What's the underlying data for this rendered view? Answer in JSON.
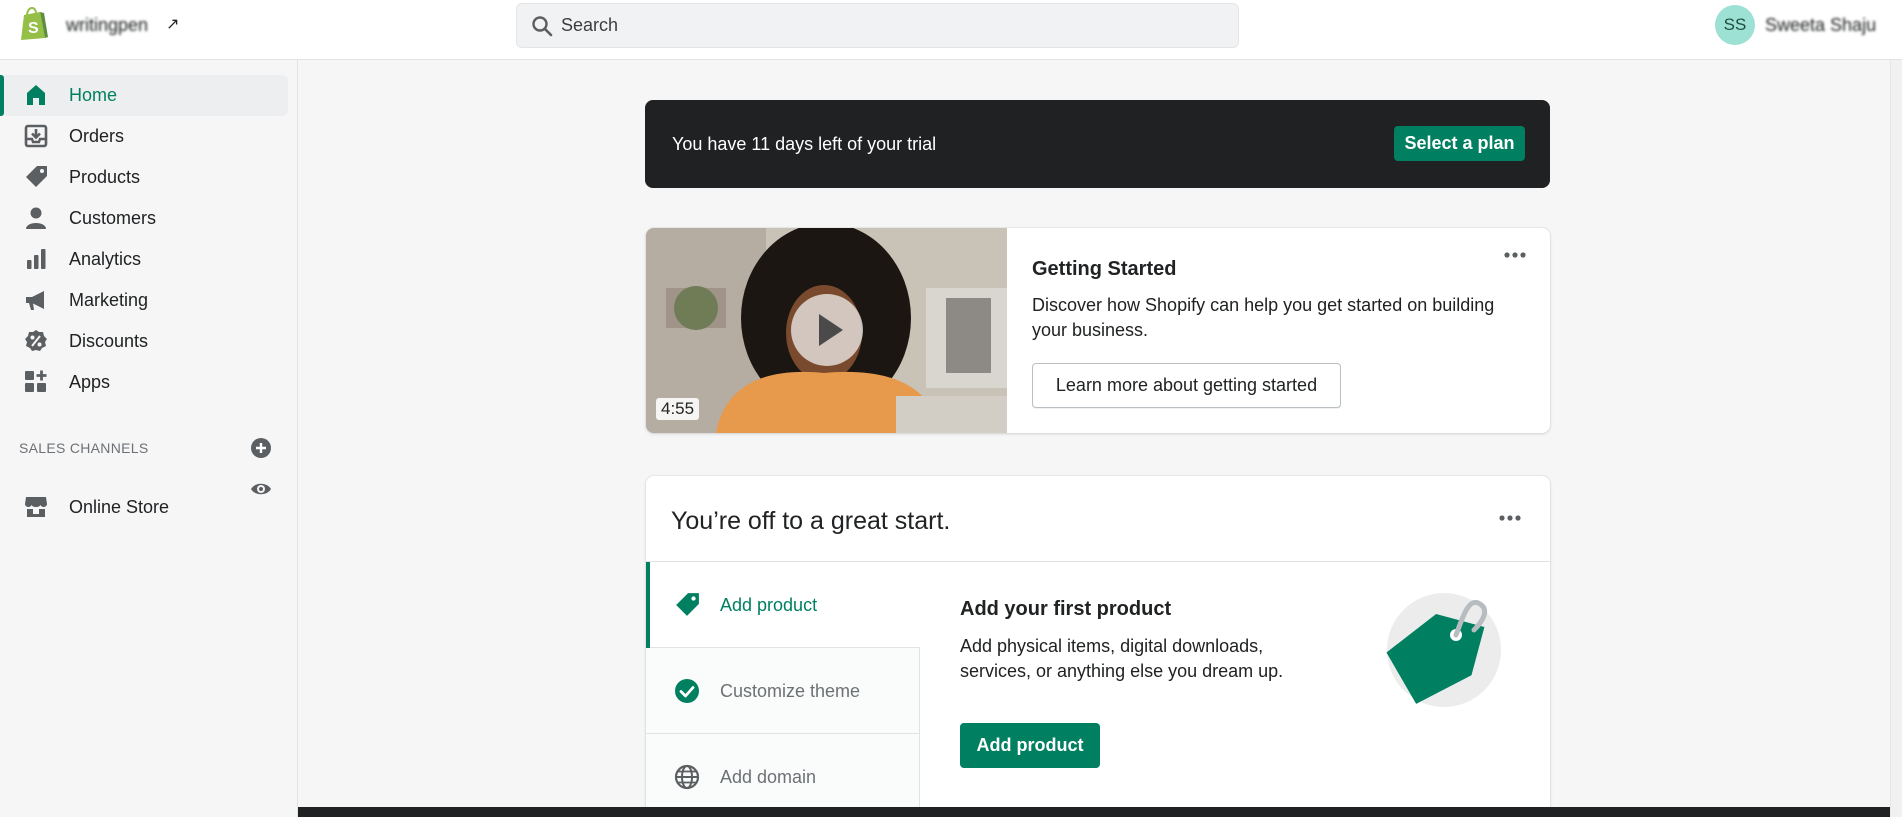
{
  "topbar": {
    "store_name": "writingpen",
    "search_placeholder": "Search",
    "avatar_initials": "SS",
    "user_name": "Sweeta Shaju"
  },
  "sidebar": {
    "items": [
      {
        "label": "Home",
        "icon": "home-icon",
        "active": true
      },
      {
        "label": "Orders",
        "icon": "orders-icon"
      },
      {
        "label": "Products",
        "icon": "tag-icon"
      },
      {
        "label": "Customers",
        "icon": "person-icon"
      },
      {
        "label": "Analytics",
        "icon": "bar-chart-icon"
      },
      {
        "label": "Marketing",
        "icon": "megaphone-icon"
      },
      {
        "label": "Discounts",
        "icon": "discount-icon"
      },
      {
        "label": "Apps",
        "icon": "apps-icon"
      }
    ],
    "sales_channels_title": "SALES CHANNELS",
    "online_store_label": "Online Store"
  },
  "trial": {
    "text": "You have 11 days left of your trial",
    "button": "Select a plan"
  },
  "getting_started": {
    "duration": "4:55",
    "title": "Getting Started",
    "description": "Discover how Shopify can help you get started on building your business.",
    "button": "Learn more about getting started"
  },
  "setup": {
    "title": "You’re off to a great start.",
    "tasks": [
      {
        "label": "Add product",
        "icon": "tag-icon",
        "active": true
      },
      {
        "label": "Customize theme",
        "icon": "check-circle-icon"
      },
      {
        "label": "Add domain",
        "icon": "globe-icon"
      }
    ],
    "detail_title": "Add your first product",
    "detail_desc": "Add physical items, digital downloads, services, or anything else you dream up.",
    "detail_button": "Add product"
  },
  "colors": {
    "brand": "#008060",
    "banner": "#202123",
    "avatar": "#9de1d4"
  }
}
